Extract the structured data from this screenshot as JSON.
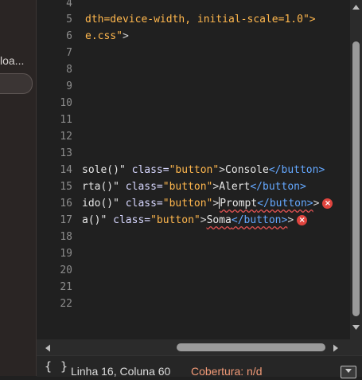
{
  "sidebar": {
    "clipped_label": "loa..."
  },
  "gutter": {
    "line_numbers": [
      "4",
      "5",
      "6",
      "7",
      "8",
      "9",
      "10",
      "11",
      "12",
      "13",
      "14",
      "15",
      "16",
      "17",
      "18",
      "19",
      "20",
      "21",
      "22"
    ]
  },
  "code": {
    "line5_a": "dth=device-width, initial-scale=1.0",
    "line5_b": "\">",
    "line6_a": "e.css\"",
    "line6_b": ">",
    "line14": {
      "fn": "sole()\"",
      "attr": " class=",
      "cls": "\"button\"",
      "tag_open": ">",
      "text": "Console",
      "close": "</button>"
    },
    "line15": {
      "fn": "rta()\"",
      "attr": " class=",
      "cls": "\"button\"",
      "tag_open": ">",
      "text": "Alert",
      "close": "</button>"
    },
    "line16": {
      "fn": "ido()\"",
      "attr": " class=",
      "cls": "\"button\"",
      "tag_open": ">",
      "text": "Prompt",
      "close": "</button>",
      "err": "×"
    },
    "line17": {
      "fn": "a()\"",
      "attr": " class=",
      "cls": "\"button\"",
      "tag_open": ">",
      "text": "Soma",
      "close": "</button>",
      "err": "×"
    }
  },
  "status": {
    "braces": "{ }",
    "position": "Linha 16, Coluna 60",
    "coverage": "Cobertura: n/d"
  },
  "icons": {
    "error": "error-circle-icon",
    "scroll_up": "arrow-up-icon",
    "scroll_down": "arrow-down-icon",
    "scroll_left": "arrow-left-icon",
    "scroll_right": "arrow-right-icon",
    "download": "download-icon"
  },
  "colors": {
    "error": "#e0443e",
    "coverage": "#f29a77",
    "string": "#ffb74d",
    "tag": "#64a8ff"
  }
}
